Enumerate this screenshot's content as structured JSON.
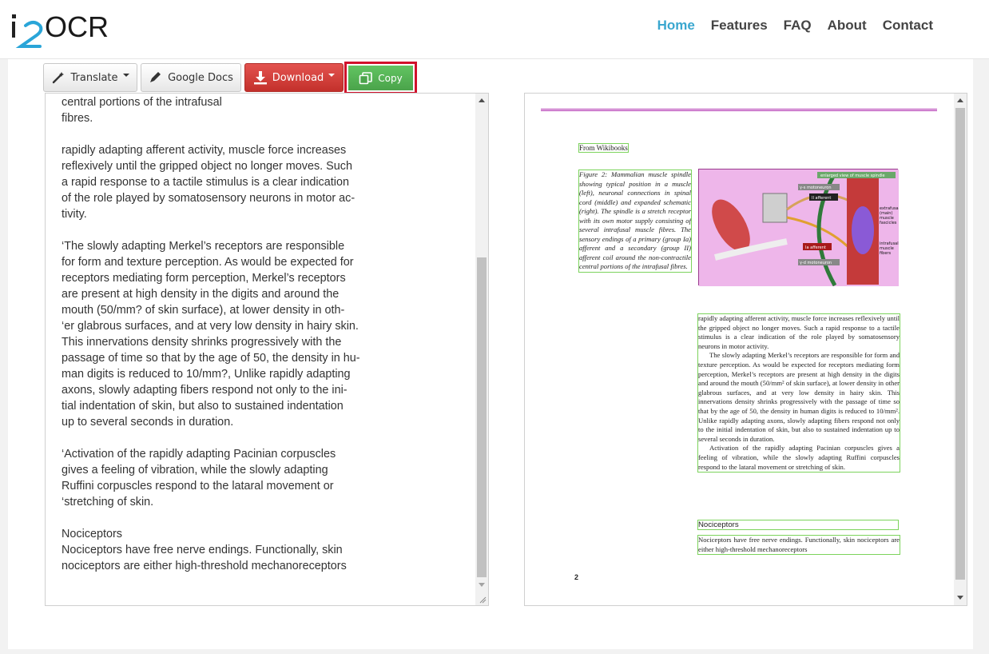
{
  "header": {
    "logo_text": "i2OCR",
    "nav": [
      {
        "label": "Home",
        "active": true
      },
      {
        "label": "Features",
        "active": false
      },
      {
        "label": "FAQ",
        "active": false
      },
      {
        "label": "About",
        "active": false
      },
      {
        "label": "Contact",
        "active": false
      }
    ]
  },
  "toolbar": {
    "translate_label": "Translate",
    "gdocs_label": "Google Docs",
    "download_label": "Download",
    "copy_label": "Copy"
  },
  "ocr_text": {
    "paragraphs": [
      "central portions of the intrafusal\nfibres.",
      "rapidly adapting afferent activity, muscle force increases\nreflexively until the gripped object no longer moves. Such\na rapid response to a tactile stimulus is a clear indication\nof the role played by somatosensory neurons in motor ac-\ntivity.",
      "‘The slowly adapting Merkel’s receptors are responsible\nfor form and texture perception. As would be expected for\nreceptors mediating form perception, Merkel’s receptors\nare present at high density in the digits and around the\nmouth (50/mm? of skin surface), at lower density in oth-\n‘er glabrous surfaces, and at very low density in hairy skin.\nThis innervations density shrinks progressively with the\npassage of time so that by the age of 50, the density in hu-\nman digits is reduced to 10/mm?, Unlike rapidly adapting\naxons, slowly adapting fibers respond not only to the ini-\ntial indentation of skin, but also to sustained indentation\nup to several seconds in duration.",
      "‘Activation of the rapidly adapting Pacinian corpuscles\ngives a feeling of vibration, while the slowly adapting\nRuffini corpuscles respond to the lataral movement or\n‘stretching of skin.",
      "Nociceptors\nNociceptors have free nerve endings. Functionally, skin\nnociceptors are either high-threshold mechanoreceptors"
    ]
  },
  "document_image": {
    "from": "From Wikibooks",
    "caption": "Figure 2: Mammalian muscle spindle showing typical position in a muscle (left), neuronal connections in spinal cord (middle) and expanded schematic (right). The spindle is a stretch receptor with its own motor supply consisting of several intrafusal muscle fibres. The sensory endings of a primary (group Ia) afferent and a secondary (group II) afferent coil around the non-contractile central portions of the intrafusal fibres.",
    "figure_labels": {
      "title": "enlarged view of muscle spindle",
      "gamma_top": "γ-s motoneuron",
      "ii_afferent": "II afferent",
      "ia_afferent": "Ia afferent",
      "gamma_bottom": "γ-d motoneuron",
      "extrafusal": "extrafusal (main) muscle fascicles",
      "intrafusal": "intrafusal muscle fibers"
    },
    "body_paragraphs": [
      "rapidly adapting afferent activity, muscle force increases reflexively until the gripped object no longer moves. Such a rapid response to a tactile stimulus is a clear indication of the role played by somatosensory neurons in motor activity.",
      "The slowly adapting Merkel’s receptors are responsible for form and texture perception. As would be expected for receptors mediating form perception, Merkel’s receptors are present at high density in the digits and around the mouth (50/mm² of skin surface), at lower density in other glabrous surfaces, and at very low density in hairy skin. This innervations density shrinks progressively with the passage of time so that by the age of 50, the density in human digits is reduced to 10/mm². Unlike rapidly adapting axons, slowly adapting fibers respond not only to the initial indentation of skin, but also to sustained indentation up to several seconds in duration.",
      "Activation of the rapidly adapting Pacinian corpuscles gives a feeling of vibration, while the slowly adapting Ruffini corpuscles respond to the lataral movement or stretching of skin."
    ],
    "nociceptors_heading": "Nociceptors",
    "nociceptors_body": "Nociceptors have free nerve endings. Functionally, skin nociceptors are either high-threshold mechanoreceptors",
    "page_number": "2"
  },
  "colors": {
    "nav_active": "#3aa7cf",
    "download_red": "#d9534f",
    "copy_green": "#5cb85c",
    "highlight_red": "#d0112b",
    "ocr_box_green": "#7cd35c"
  }
}
